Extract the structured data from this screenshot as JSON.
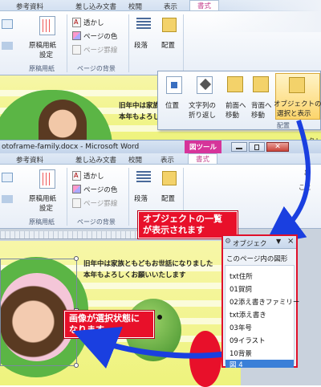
{
  "top_ribbon": {
    "tabs": [
      "参考資料",
      "差し込み文書",
      "校閲",
      "表示",
      "書式"
    ],
    "buttons": {
      "watermark": "透かし",
      "page_color": "ページの色",
      "page_border": "ページ罫線",
      "genko_line1": "原稿用紙",
      "genko_line2": "設定",
      "paragraph": "段落",
      "arrange": "配置"
    },
    "groups": {
      "genko": "原稿用紙",
      "page_bg": "ページの背景"
    }
  },
  "arrange_popup": {
    "buttons": {
      "position": "位置",
      "wrap_line1": "文字列の",
      "wrap_line2": "折り返し",
      "front_line1": "前面へ",
      "front_line2": "移動",
      "back_line1": "背面へ",
      "back_line2": "移動",
      "select_line1": "オブジェクトの",
      "select_line2": "選択と表示"
    },
    "group_label": "配置"
  },
  "card_text": {
    "line1": "旧年中は家族ともどもお世話になりました",
    "line2": "本年もよろしくお願いいたします"
  },
  "window": {
    "title": "otoframe-family.docx - Microsoft Word",
    "context_tab": "図ツール"
  },
  "bottom_ribbon": {
    "tabs": [
      "参考資料",
      "差し込み文書",
      "校閲",
      "表示",
      "書式"
    ],
    "buttons": {
      "watermark": "透かし",
      "page_color": "ページの色",
      "page_border": "ページ罫線",
      "genko_line1": "原稿用紙",
      "genko_line2": "設定",
      "paragraph": "段落",
      "arrange": "配置"
    },
    "groups": {
      "genko": "原稿用紙",
      "page_bg": "ページの背景"
    }
  },
  "callouts": {
    "list_line1": "オブジェクトの一覧",
    "list_line2": "が表示されます",
    "selected_line1": "画像が選択状態に",
    "selected_line2": "なります"
  },
  "selection_pane": {
    "title": "オブジェク",
    "close": "×",
    "header": "このページ内の図形",
    "items": [
      "txt住所",
      "01賀詞",
      "02添え書きファミリー",
      "txt添え書き",
      "03年号",
      "09イラスト",
      "10背景",
      "図 4"
    ],
    "selected_index": 7
  },
  "side_text": {
    "right_line1": "ェクト",
    "right_line2": "と",
    "right_line3": "こと"
  },
  "colors": {
    "callout_red": "#e8102a",
    "arrow_blue": "#1a3fe0",
    "pane_border": "#e0102a",
    "selected_row": "#3a7fd8"
  }
}
